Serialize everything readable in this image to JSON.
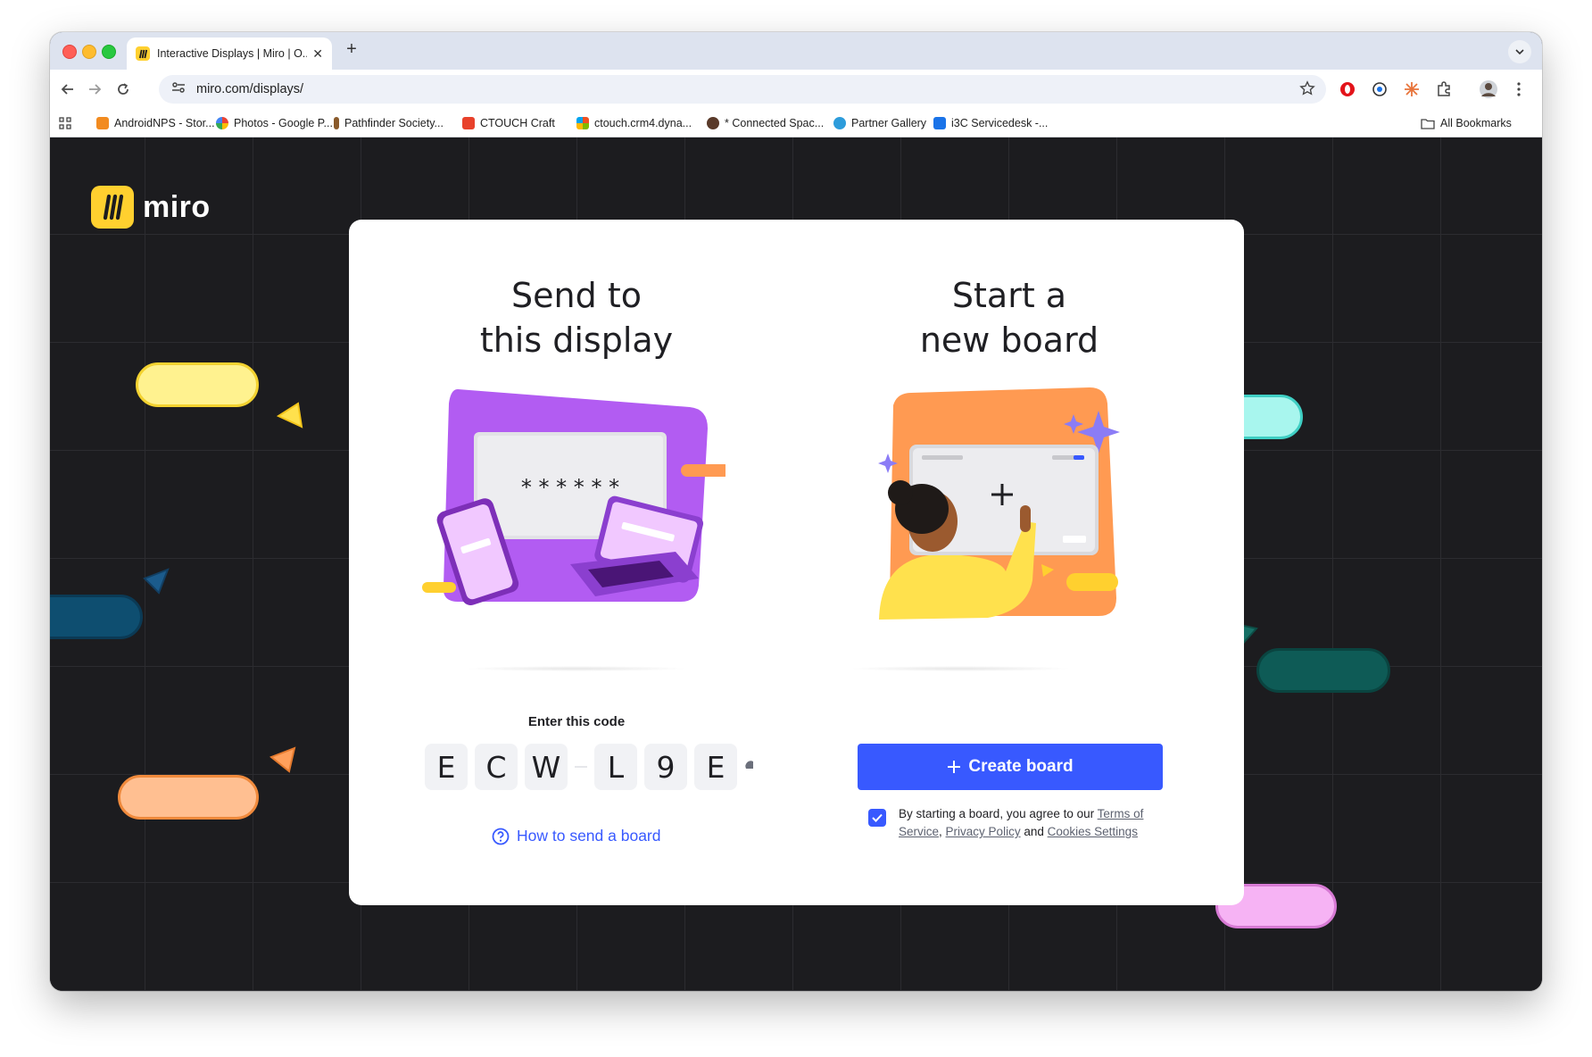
{
  "browser": {
    "tab_title": "Interactive Displays | Miro | O...",
    "url": "miro.com/displays/",
    "bookmarks": [
      {
        "label": "AndroidNPS - Stor...",
        "color": "#f28b20"
      },
      {
        "label": "Photos - Google P...",
        "color": "#ea4335"
      },
      {
        "label": "Pathfinder Society...",
        "color": "#8a5a2b"
      },
      {
        "label": "CTOUCH Craft",
        "color": "#e8412b"
      },
      {
        "label": "ctouch.crm4.dyna...",
        "color": "#00a4ef"
      },
      {
        "label": "* Connected Spac...",
        "color": "#5a3a2a"
      },
      {
        "label": "Partner Gallery",
        "color": "#2d9cdb"
      },
      {
        "label": "i3C Servicedesk -...",
        "color": "#1a73e8"
      }
    ],
    "all_bookmarks_label": "All Bookmarks"
  },
  "logo": {
    "text": "miro",
    "color": "#ffd02f"
  },
  "send": {
    "heading": "Send to\nthis display",
    "code_label": "Enter this code",
    "code": [
      "E",
      "C",
      "W",
      "L",
      "9",
      "E"
    ],
    "password_mask": "* * * * * *",
    "help_link": "How to send a board"
  },
  "start": {
    "heading": "Start a\nnew board",
    "create_button": "Create board",
    "consent_prefix": "By starting a board, you agree to our",
    "terms_link": "Terms of Service",
    "separator": ",",
    "privacy_link": "Privacy Policy",
    "and_text": "and",
    "cookies_link": "Cookies Settings",
    "consent_checked": true
  },
  "colors": {
    "accent": "#3859ff",
    "background": "#1c1c1f",
    "purple": "#b15cf0",
    "orange": "#ff9a52"
  }
}
